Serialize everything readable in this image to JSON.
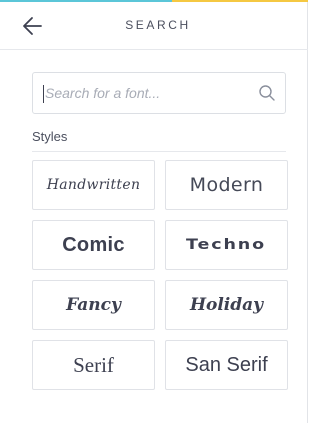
{
  "colors": {
    "accent_left": "#5bc6d8",
    "accent_right": "#f5c842"
  },
  "header": {
    "back_icon": "arrow-left-icon",
    "title": "SEARCH"
  },
  "search": {
    "value": "",
    "placeholder": "Search for a font...",
    "icon": "search-icon"
  },
  "styles": {
    "heading": "Styles",
    "items": [
      {
        "label": "Handwritten"
      },
      {
        "label": "Modern"
      },
      {
        "label": "Comic"
      },
      {
        "label": "Techno"
      },
      {
        "label": "Fancy"
      },
      {
        "label": "Holiday"
      },
      {
        "label": "Serif"
      },
      {
        "label": "San Serif"
      }
    ]
  }
}
